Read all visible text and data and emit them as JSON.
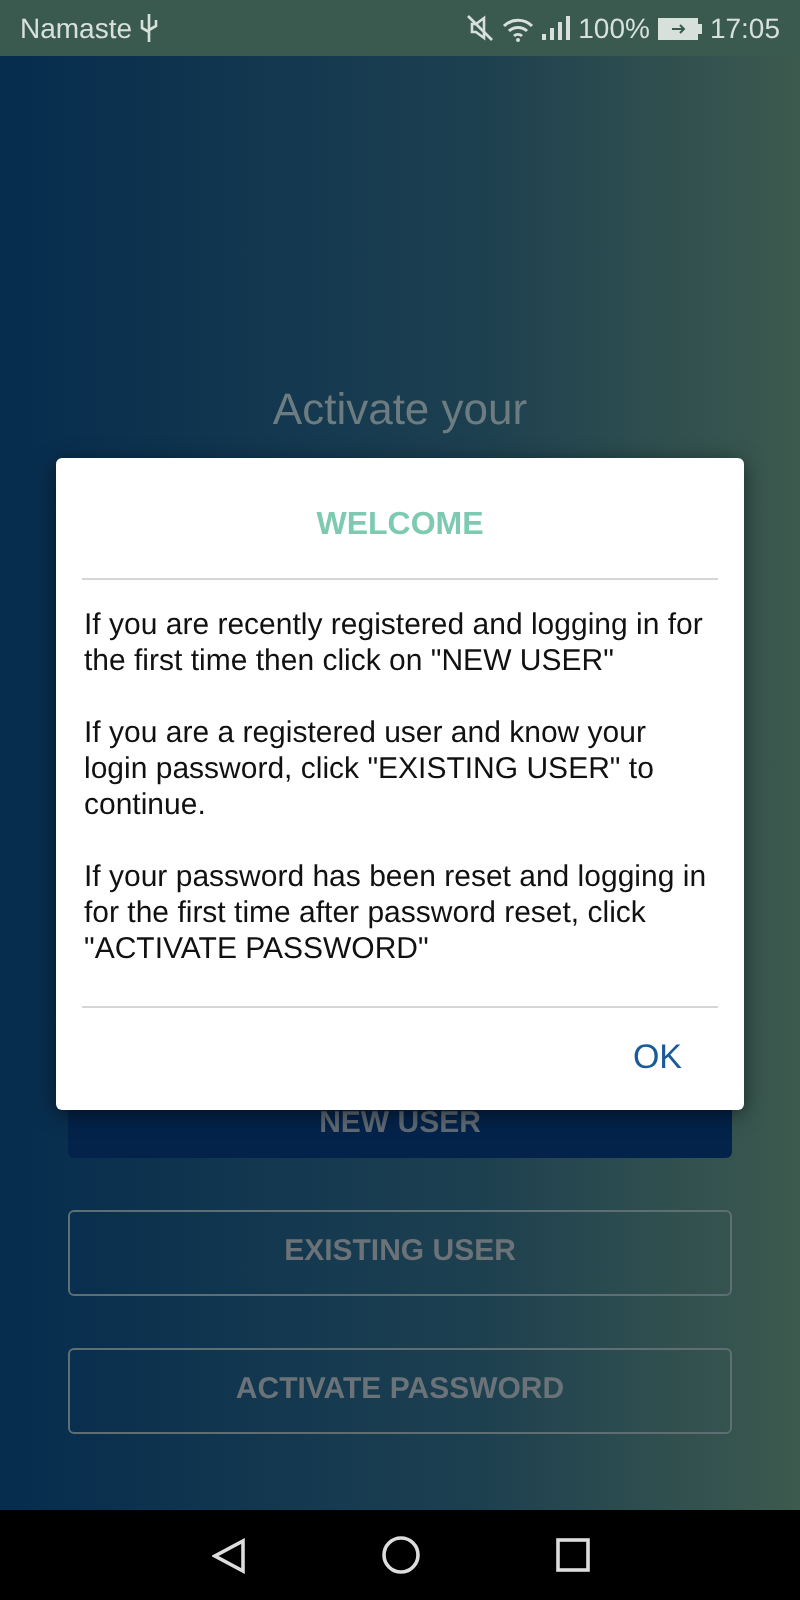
{
  "status_bar": {
    "carrier": "Namaste",
    "battery": "100%",
    "time": "17:05"
  },
  "heading": "Activate your",
  "buttons": [
    {
      "label": "NEW USER",
      "kind": "filled"
    },
    {
      "label": "EXISTING USER",
      "kind": "outline"
    },
    {
      "label": "ACTIVATE PASSWORD",
      "kind": "outline"
    }
  ],
  "dialog": {
    "title": "WELCOME",
    "paragraphs": [
      "If you are recently registered and logging in for the first time then click on \"NEW USER\"",
      "If you are a registered user and know your login password, click \"EXISTING USER\" to continue.",
      "If your password has been reset and logging in for the first time after password reset, click \"ACTIVATE PASSWORD\""
    ],
    "button": "OK"
  }
}
